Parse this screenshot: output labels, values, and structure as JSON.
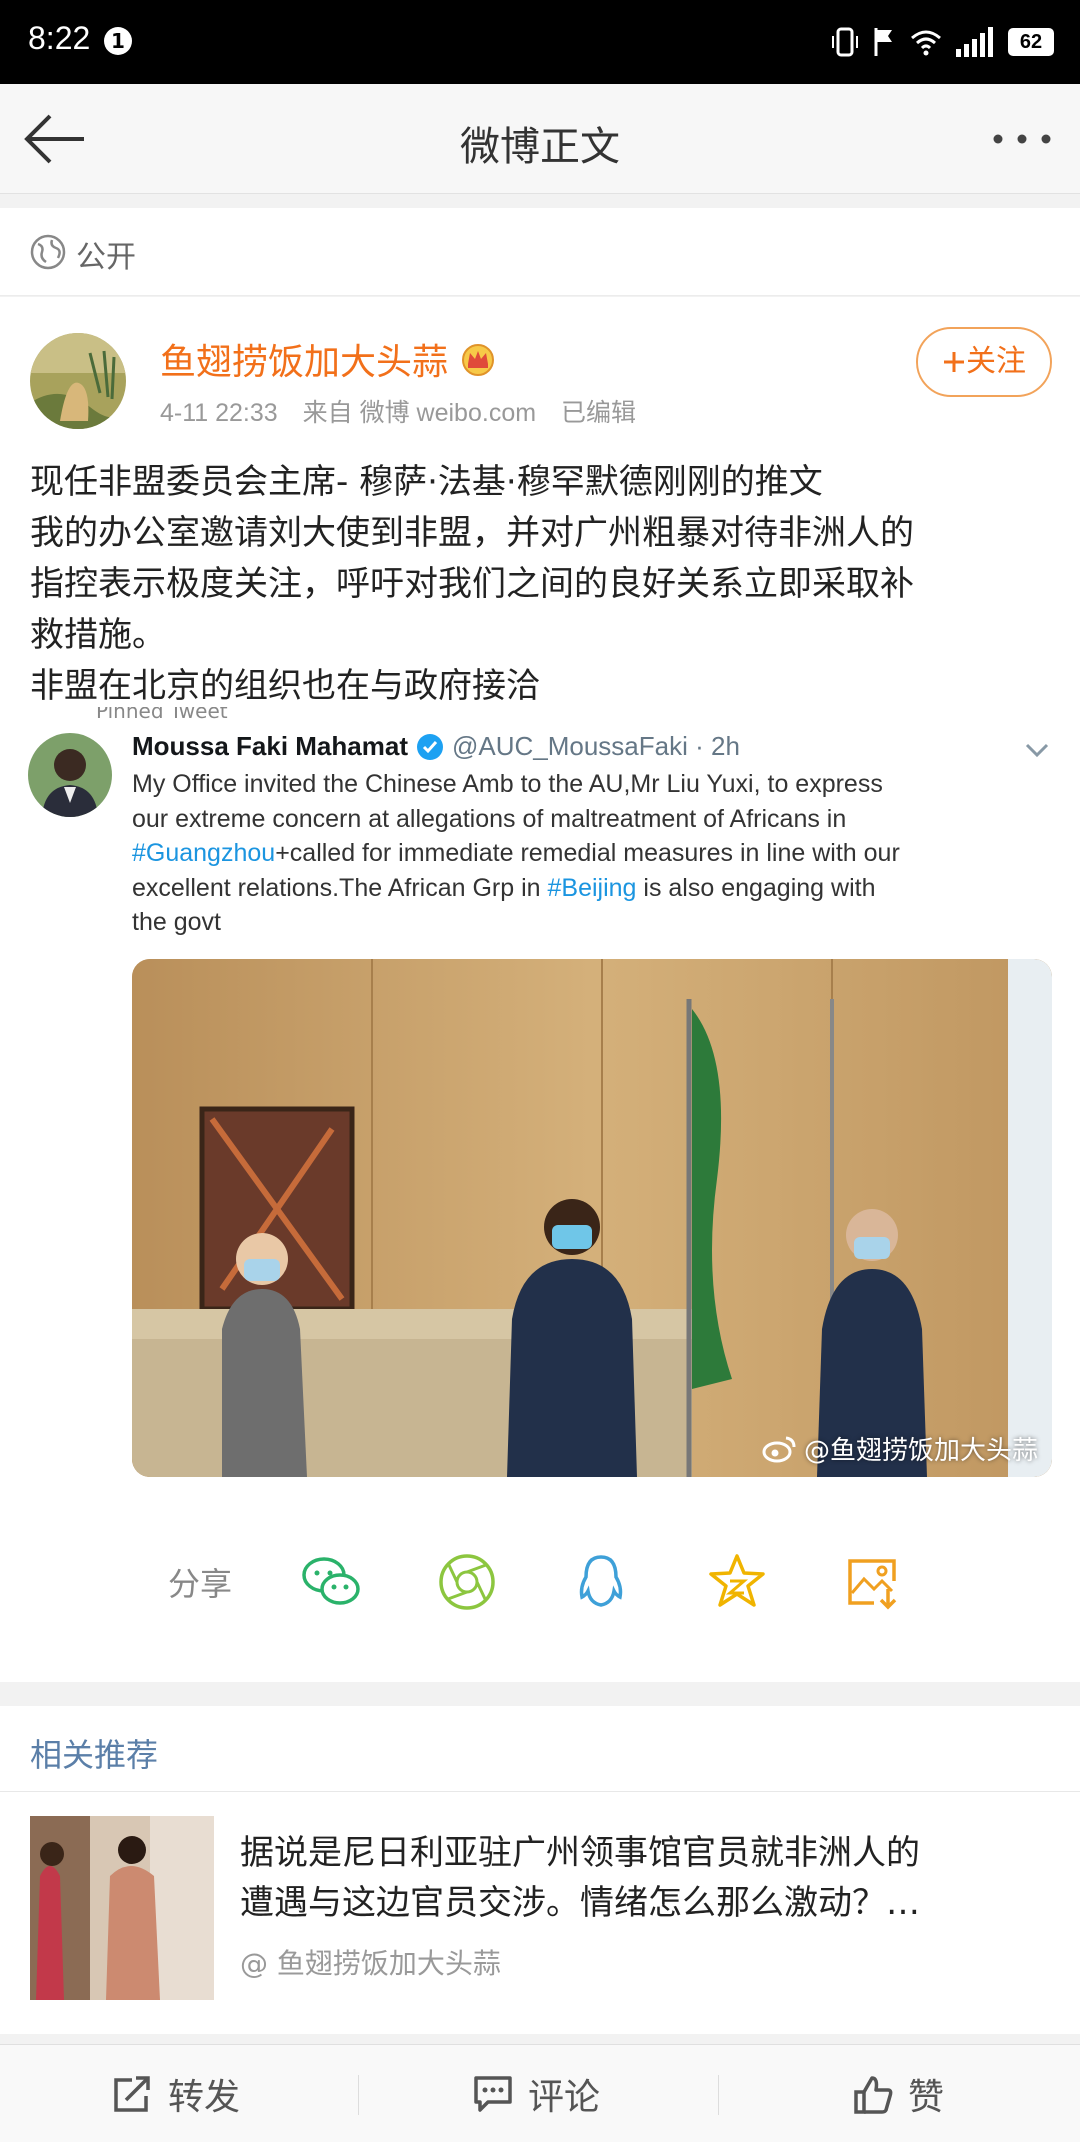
{
  "status_bar": {
    "time": "8:22",
    "notification_count": "1",
    "battery": "62"
  },
  "nav": {
    "title": "微博正文"
  },
  "visibility": {
    "label": "公开"
  },
  "post": {
    "author": "鱼翅捞饭加大头蒜",
    "time": "4-11 22:33",
    "source": "来自 微博 weibo.com",
    "edited": "已编辑",
    "follow_label": "关注",
    "text_lines": [
      "现任非盟委员会主席- 穆萨·法基·穆罕默德刚刚的推文",
      "我的办公室邀请刘大使到非盟，并对广州粗暴对待非洲人的",
      "指控表示极度关注，呼吁对我们之间的良好关系立即采取补",
      "救措施。",
      "非盟在北京的组织也在与政府接洽"
    ]
  },
  "tweet": {
    "pinned": "Pinned Tweet",
    "name": "Moussa Faki Mahamat",
    "handle": "@AUC_MoussaFaki · 2h",
    "line1": "My Office invited the Chinese Amb to the AU,Mr Liu Yuxi, to express",
    "line2": "our extreme concern at allegations of maltreatment of Africans in",
    "line3_tag": "#Guangzhou",
    "line3_rest": "+called for immediate remedial measures in line with our",
    "line4_pre": "excellent relations.The African Grp in ",
    "line4_tag": "#Beijing",
    "line4_post": " is also engaging with",
    "line5": "the govt",
    "watermark": "@鱼翅捞饭加大头蒜"
  },
  "share": {
    "label": "分享",
    "icons": [
      "wechat-icon",
      "moments-icon",
      "qq-icon",
      "qzone-icon",
      "save-image-icon"
    ]
  },
  "related": {
    "header": "相关推荐",
    "title_line1": "据说是尼日利亚驻广州领事馆官员就非洲人的",
    "title_line2": "遭遇与这边官员交涉。情绪怎么那么激动？…",
    "source": "@ 鱼翅捞饭加大头蒜"
  },
  "actions": {
    "repost": "转发",
    "comment": "评论",
    "like": "赞"
  },
  "colors": {
    "author": "#f2701a",
    "link": "#1b95e0",
    "related_header": "#5b7fa8",
    "share_green": "#2ab26a",
    "share_blue": "#3ea0d8",
    "share_yellow": "#f0b400"
  }
}
